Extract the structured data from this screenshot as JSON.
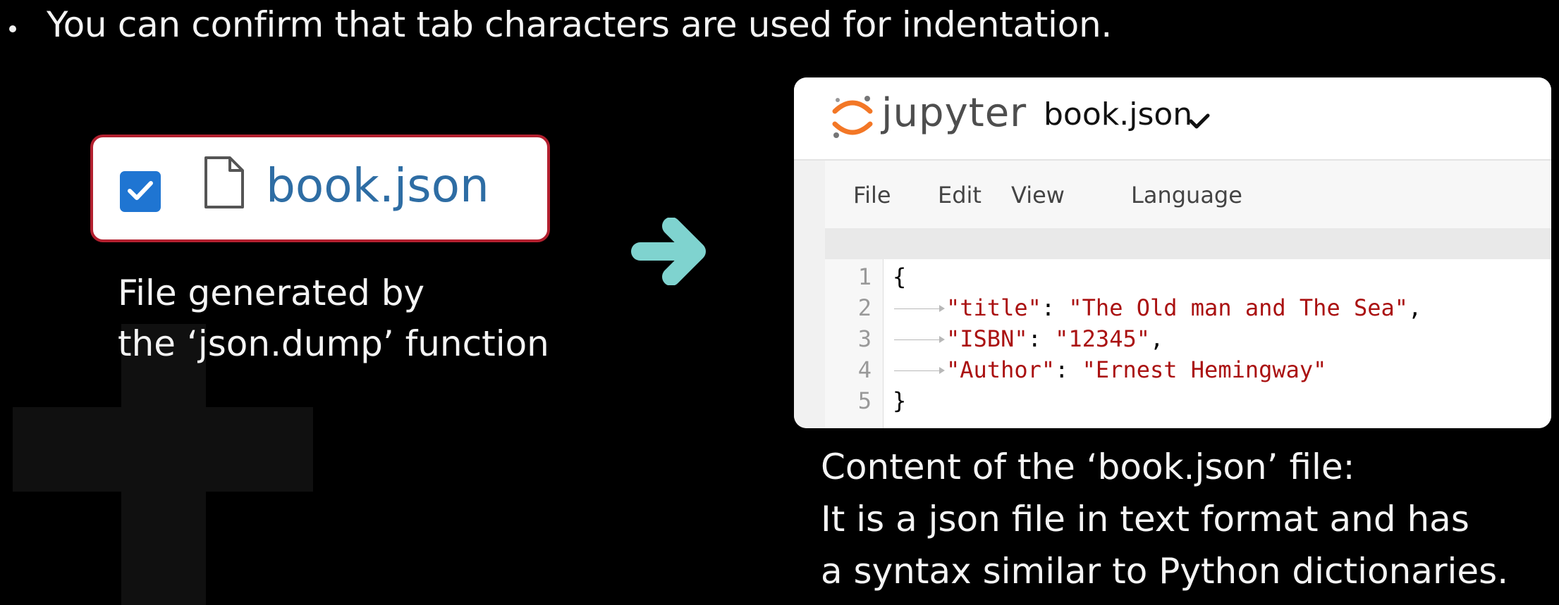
{
  "bullet": "You can confirm that tab characters are used for indentation.",
  "file_entry": {
    "name": "book.json",
    "checked": true,
    "checkbox_color": "#1f75d2",
    "border_color": "#b3202f",
    "name_color": "#2e6da4"
  },
  "caption_left": {
    "line1": "File generated by",
    "line2": "the ‘json.dump’ function"
  },
  "arrow_color": "#7fd3cf",
  "jupyter": {
    "brand": "jupyter",
    "filename": "book.json",
    "menu": [
      "File",
      "Edit",
      "View",
      "Language"
    ],
    "lines": [
      {
        "num": "1",
        "text": "{",
        "tab": false
      },
      {
        "num": "2",
        "key": "\"title\"",
        "sep": ": ",
        "value": "\"The Old man and The Sea\"",
        "end": ",",
        "tab": true
      },
      {
        "num": "3",
        "key": "\"ISBN\"",
        "sep": ": ",
        "value": "\"12345\"",
        "end": ",",
        "tab": true
      },
      {
        "num": "4",
        "key": "\"Author\"",
        "sep": ": ",
        "value": "\"Ernest Hemingway\"",
        "end": "",
        "tab": true
      },
      {
        "num": "5",
        "text": "}",
        "tab": false
      }
    ],
    "string_color": "#aa1111"
  },
  "caption_right": {
    "line1": "Content of the ‘book.json’ file:",
    "line2": "It is a json file in text format and has",
    "line3": "a syntax similar to Python dictionaries."
  }
}
